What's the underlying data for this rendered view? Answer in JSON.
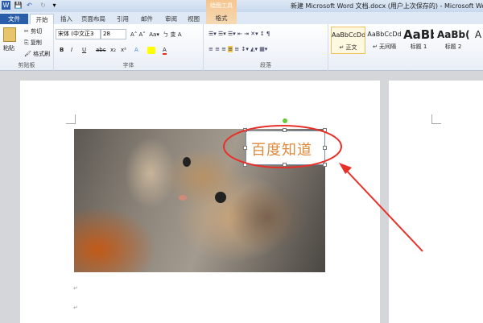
{
  "window": {
    "title": "新建 Microsoft Word 文档.docx (用户上次保存的) - Microsoft Word"
  },
  "quick_access": {
    "word": "W",
    "save": "💾",
    "undo": "↶",
    "redo": "↻",
    "more": "▾"
  },
  "contextual_tab_group": "绘图工具",
  "tabs": [
    "文件",
    "开始",
    "插入",
    "页面布局",
    "引用",
    "邮件",
    "审阅",
    "视图",
    "格式"
  ],
  "clipboard": {
    "paste": "粘贴",
    "cut": "剪切",
    "copy": "复制",
    "format_painter": "格式刷",
    "label": "剪贴板"
  },
  "font": {
    "name": "宋体 (中文正3",
    "size": "28",
    "label": "字体",
    "buttons": [
      "B",
      "I",
      "U",
      "abc",
      "x₂",
      "x²",
      "A",
      "A"
    ]
  },
  "paragraph": {
    "label": "段落"
  },
  "styles": [
    {
      "preview": "AaBbCcDd",
      "name": "↵ 正文"
    },
    {
      "preview": "AaBbCcDd",
      "name": "↵ 无间隔"
    },
    {
      "preview": "AaBb",
      "name": "标题 1"
    },
    {
      "preview": "AaBb(",
      "name": "标题 2"
    },
    {
      "preview": "A",
      "name": ""
    }
  ],
  "document": {
    "textbox_text": "百度知道",
    "paragraph_mark": "↵"
  },
  "colors": {
    "annotation": "#e8302a",
    "textbox_text": "#e08a3c"
  }
}
